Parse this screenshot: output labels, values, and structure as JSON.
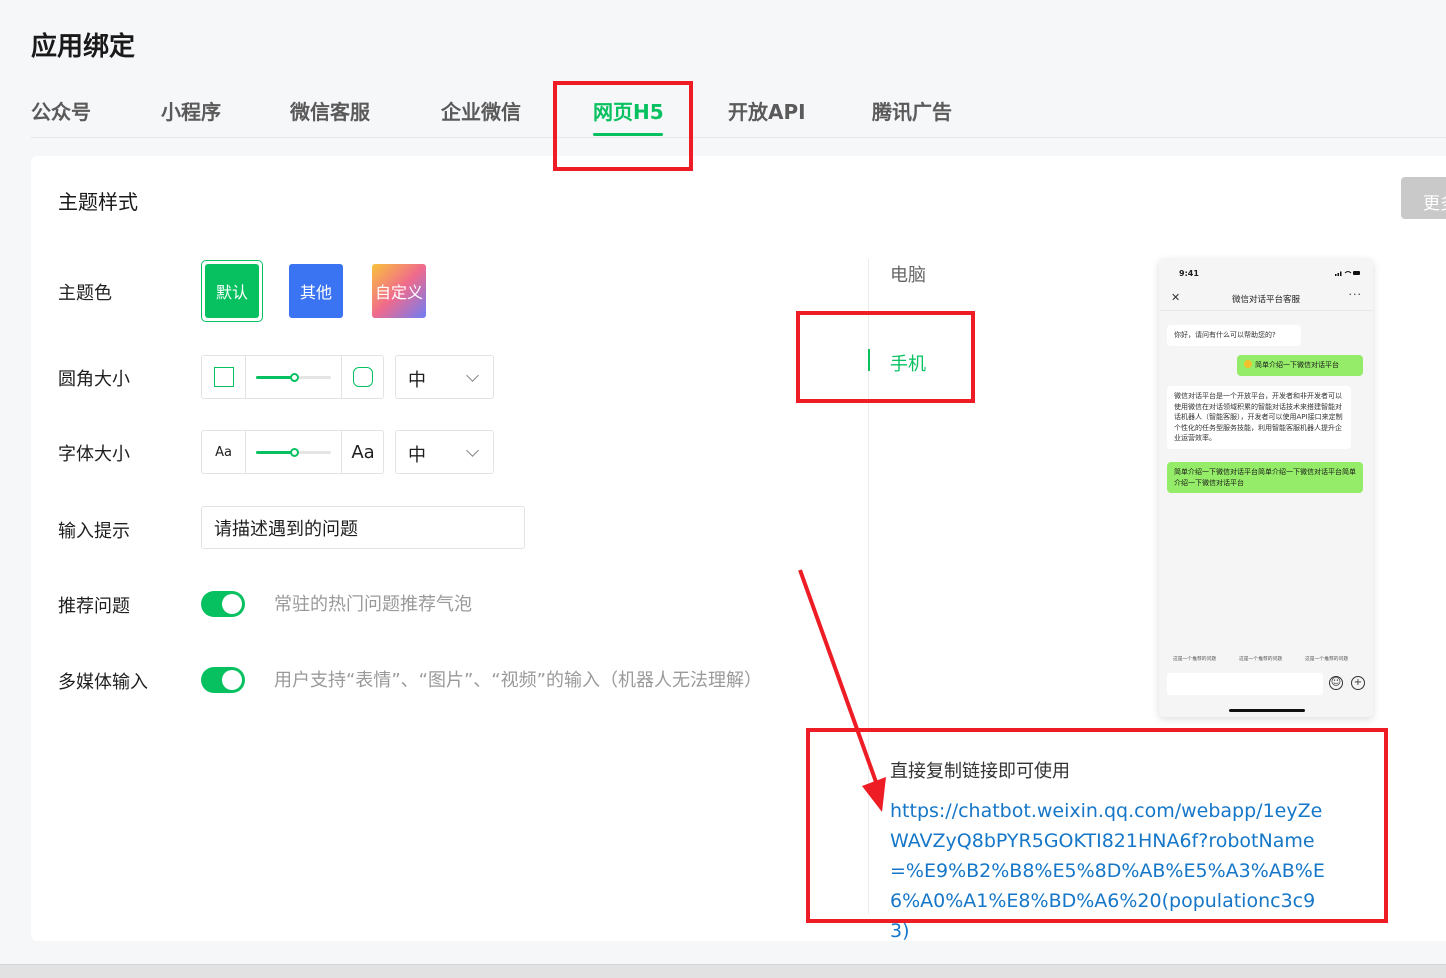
{
  "page": {
    "title": "应用绑定"
  },
  "tabs": [
    {
      "label": "公众号"
    },
    {
      "label": "小程序"
    },
    {
      "label": "微信客服"
    },
    {
      "label": "企业微信"
    },
    {
      "label": "网页H5",
      "active": true
    },
    {
      "label": "开放API"
    },
    {
      "label": "腾讯广告"
    }
  ],
  "section": {
    "title": "主题样式",
    "more_label": "更多"
  },
  "form": {
    "theme": {
      "label": "主题色",
      "options": [
        "默认",
        "其他",
        "自定义"
      ],
      "selected": "默认"
    },
    "corner": {
      "label": "圆角大小",
      "value": "中",
      "slider_fraction": 0.5
    },
    "font": {
      "label": "字体大小",
      "small_glyph": "Aa",
      "large_glyph": "Aa",
      "value": "中",
      "slider_fraction": 0.5
    },
    "input_hint": {
      "label": "输入提示",
      "value": "请描述遇到的问题"
    },
    "recommend": {
      "label": "推荐问题",
      "enabled": true,
      "hint": "常驻的热门问题推荐气泡"
    },
    "multimedia": {
      "label": "多媒体输入",
      "enabled": true,
      "hint": "用户支持“表情”、“图片”、“视频”的输入（机器人无法理解）"
    }
  },
  "preview": {
    "devices": [
      "电脑",
      "手机"
    ],
    "selected_device": "手机",
    "phone": {
      "time": "9:41",
      "title": "微信对话平台客服",
      "messages": [
        {
          "side": "left",
          "text": "你好，请问有什么可以帮助您的?"
        },
        {
          "side": "right",
          "text": "简单介绍一下微信对话平台"
        },
        {
          "side": "left",
          "text": "微信对话平台是一个开放平台，开发者和非开发者可以使用微信在对话领域积累的智能对话技术来搭建智能对话机器人（智能客服），开发者可以使用API接口来定制个性化的任务型服务技能，利用智能客服机器人提升企业运营效率。"
        },
        {
          "side": "right",
          "text": "简单介绍一下微信对话平台简单介绍一下微信对话平台简单介绍一下微信对话平台"
        }
      ],
      "recommend": [
        "这是一个推荐的问题",
        "这是一个推荐的问题",
        "这是一个推荐的问题"
      ]
    }
  },
  "copy": {
    "label": "直接复制链接即可使用",
    "link": "https://chatbot.weixin.qq.com/webapp/1eyZeWAVZyQ8bPYR5GOKTI821HNA6f?robotName=%E9%B2%B8%E5%8D%AB%E5%A3%AB%E6%A0%A1%E8%BD%A6%20(populationc3c93)"
  },
  "colors": {
    "accent": "#07c160",
    "theme_other": "#3a74f2",
    "link": "#1677c9",
    "annotation": "#ee1c25"
  }
}
